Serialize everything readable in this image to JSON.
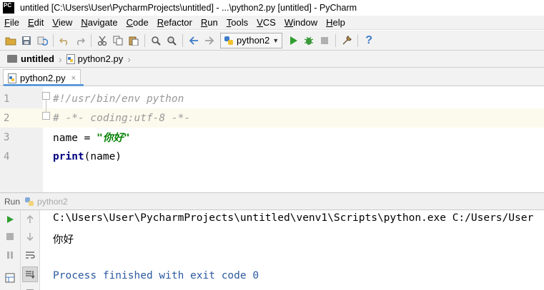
{
  "window": {
    "logo_text": "PC",
    "title": "untitled [C:\\Users\\User\\PycharmProjects\\untitled] - ...\\python2.py [untitled] - PyCharm"
  },
  "menu": [
    {
      "mnemonic": "F",
      "rest": "ile"
    },
    {
      "mnemonic": "E",
      "rest": "dit"
    },
    {
      "mnemonic": "V",
      "rest": "iew"
    },
    {
      "mnemonic": "N",
      "rest": "avigate"
    },
    {
      "mnemonic": "C",
      "rest": "ode"
    },
    {
      "mnemonic": "R",
      "rest": "efactor"
    },
    {
      "mnemonic": "R",
      "rest": "un"
    },
    {
      "mnemonic": "T",
      "rest": "ools"
    },
    {
      "mnemonic": "V",
      "rest": "CS"
    },
    {
      "mnemonic": "W",
      "rest": "indow"
    },
    {
      "mnemonic": "H",
      "rest": "elp"
    }
  ],
  "toolbar": {
    "run_config": "python2",
    "colors": {
      "run": "#2e9e2e",
      "debug": "#3a9a3a",
      "stop": "#b0b0b0",
      "help": "#3d7cc9"
    }
  },
  "navbar": {
    "project": "untitled",
    "file": "python2.py"
  },
  "tab": {
    "label": "python2.py",
    "close": "×"
  },
  "editor": {
    "lines": [
      {
        "num": "1",
        "parts": [
          {
            "cls": "comment",
            "text": "#!/usr/bin/env python"
          }
        ]
      },
      {
        "num": "2",
        "parts": [
          {
            "cls": "comment",
            "text": "# -*- coding:utf-8 -*-"
          }
        ]
      },
      {
        "num": "3",
        "parts": [
          {
            "cls": "",
            "text": "name = "
          },
          {
            "cls": "str",
            "text": "\"你好\""
          }
        ]
      },
      {
        "num": "4",
        "parts": [
          {
            "cls": "kw",
            "text": "print"
          },
          {
            "cls": "",
            "text": "(name)"
          }
        ]
      }
    ]
  },
  "run_panel": {
    "label": "Run",
    "config": "python2"
  },
  "console": {
    "command": "C:\\Users\\User\\PycharmProjects\\untitled\\venv1\\Scripts\\python.exe C:/Users/User",
    "output": "你好",
    "exit": "Process finished with exit code 0"
  }
}
